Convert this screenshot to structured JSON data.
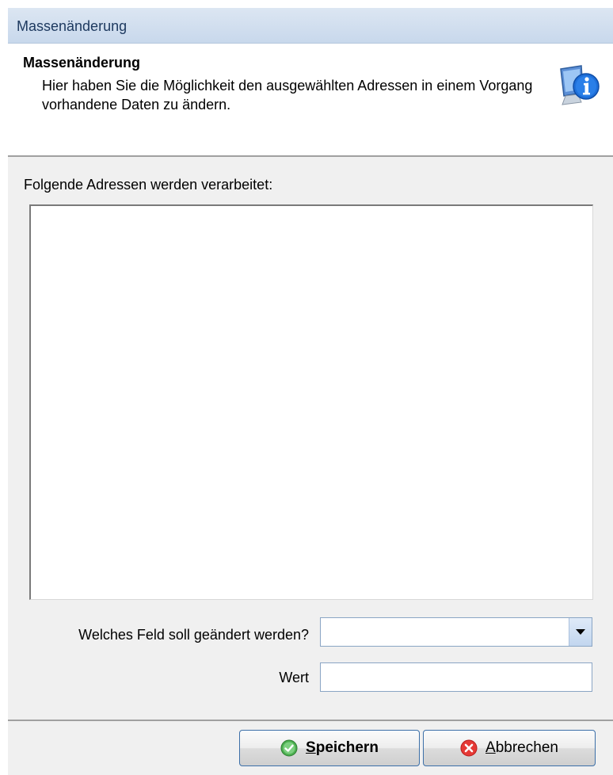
{
  "window": {
    "title": "Massenänderung"
  },
  "header": {
    "title": "Massenänderung",
    "description": "Hier haben Sie die Möglichkeit den ausgewählten Adressen in einem Vorgang vorhandene Daten zu ändern.",
    "icon": "info-monitor-icon"
  },
  "list": {
    "label": "Folgende Adressen werden verarbeitet:",
    "items": []
  },
  "form": {
    "field_label": "Welches Feld soll geändert werden?",
    "field_value": "",
    "value_label": "Wert",
    "value_value": ""
  },
  "buttons": {
    "save_label": "Speichern",
    "save_icon": "check-circle-icon",
    "cancel_label": "Abbrechen",
    "cancel_icon": "x-circle-icon"
  },
  "colors": {
    "title_bar": "#dce6f2",
    "save_icon": "#4caf50",
    "cancel_icon": "#e53935",
    "info_icon": "#1e6fd9"
  }
}
